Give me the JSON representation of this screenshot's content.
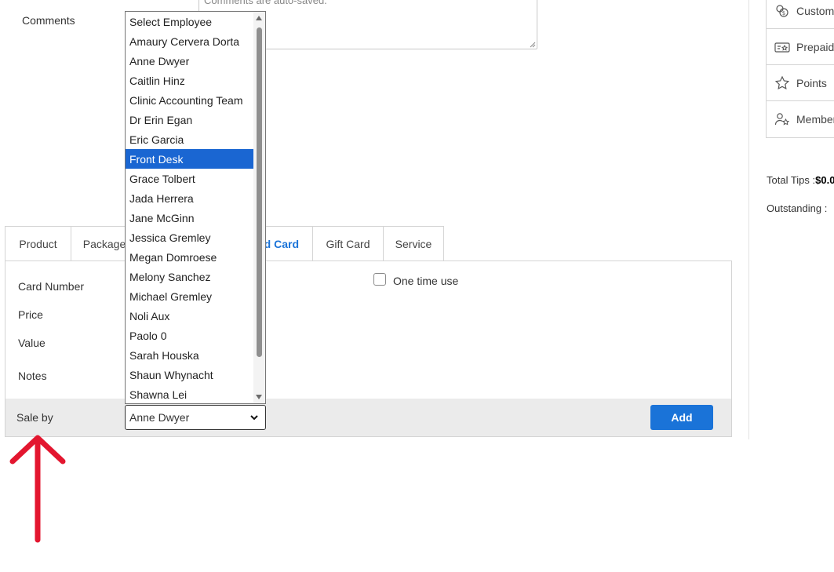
{
  "comments": {
    "label": "Comments",
    "placeholder": "Comments are auto-saved."
  },
  "sidebar": {
    "items": [
      {
        "label": "Custom",
        "icon": "customer-credit-icon"
      },
      {
        "label": "Prepaid",
        "icon": "prepaid-card-icon"
      },
      {
        "label": "Points",
        "icon": "star-icon"
      },
      {
        "label": "Member",
        "icon": "member-icon"
      }
    ],
    "total_tips_label": "Total Tips :",
    "total_tips_value": "$0.0",
    "outstanding_label": "Outstanding :"
  },
  "tabs": [
    {
      "label": "Product"
    },
    {
      "label": "Package"
    },
    {
      "label": "Prepaid Card",
      "active": true
    },
    {
      "label": "Gift Card"
    },
    {
      "label": "Service"
    }
  ],
  "form": {
    "card_number_label": "Card Number",
    "price_label": "Price",
    "value_label": "Value",
    "notes_label": "Notes",
    "one_time_use_label": "One time use",
    "sale_by_label": "Sale by",
    "sale_by_value": "Anne Dwyer",
    "add_label": "Add"
  },
  "employee_dropdown": {
    "highlighted": "Front Desk",
    "options": [
      "Select Employee",
      "Amaury Cervera Dorta",
      "Anne Dwyer",
      "Caitlin Hinz",
      "Clinic Accounting Team",
      "Dr Erin Egan",
      "Eric Garcia",
      "Front Desk",
      "Grace Tolbert",
      "Jada Herrera",
      "Jane McGinn",
      "Jessica Gremley",
      "Megan Domroese",
      "Melony Sanchez",
      "Michael Gremley",
      "Noli Aux",
      "Paolo 0",
      "Sarah Houska",
      "Shaun Whynacht",
      "Shawna Lei"
    ]
  },
  "colors": {
    "accent": "#1a73d8",
    "highlight": "#1a66d2",
    "annotation_arrow": "#e3162f"
  }
}
